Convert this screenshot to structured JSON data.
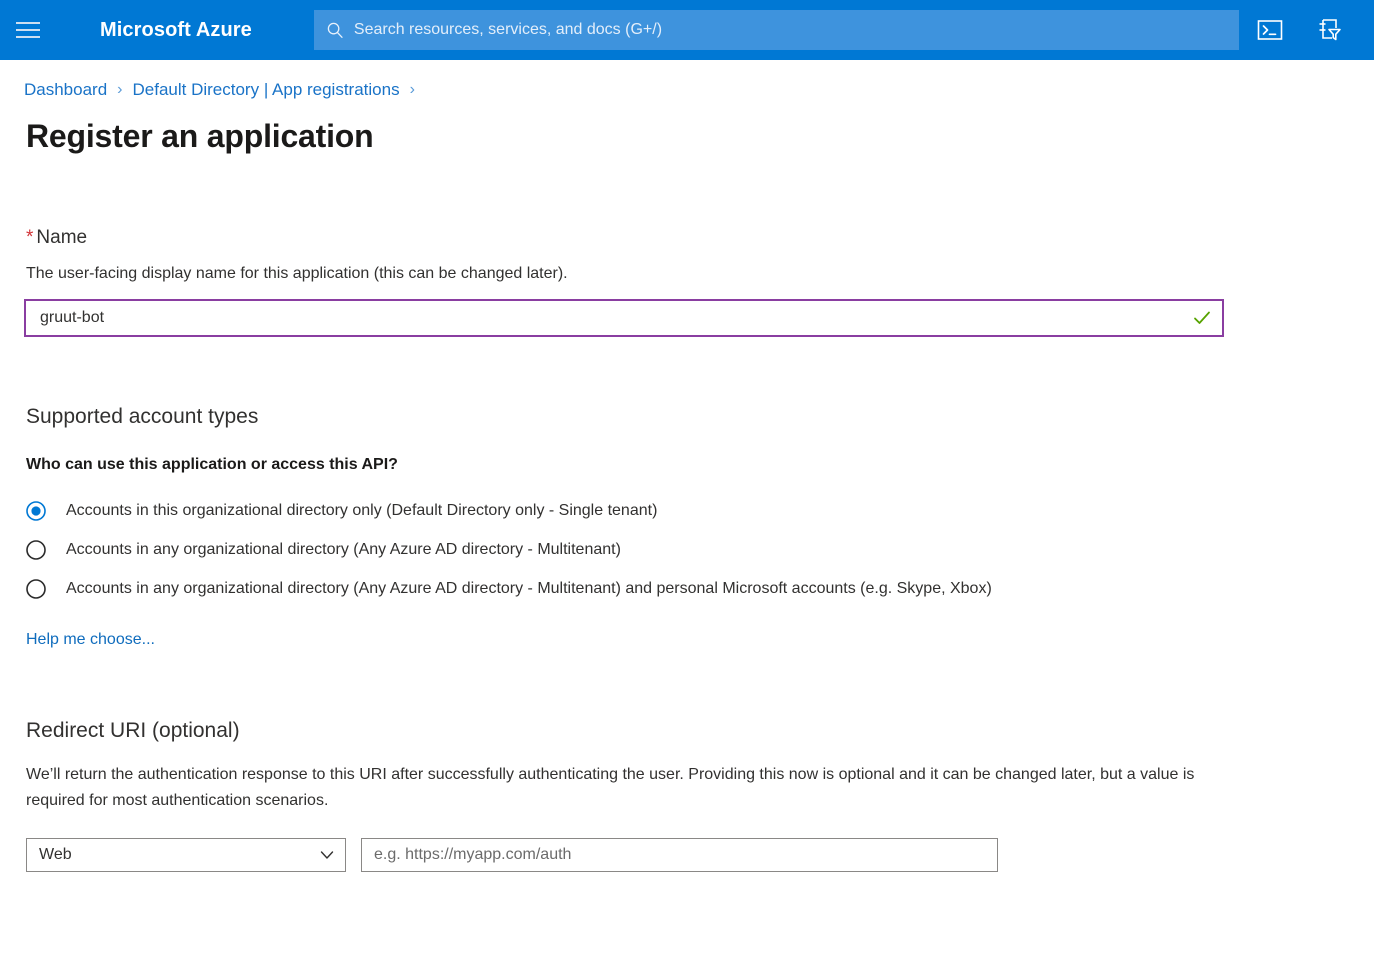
{
  "header": {
    "menu_icon": "hamburger-icon",
    "brand": "Microsoft Azure",
    "search": {
      "icon": "search-icon",
      "placeholder": "Search resources, services, and docs (G+/)",
      "value": ""
    },
    "icons": [
      {
        "name": "cloud-shell-icon",
        "label": "Cloud Shell"
      },
      {
        "name": "directories-filter-icon",
        "label": "Directories + subscriptions"
      }
    ],
    "background_color": "#0078d4",
    "search_background_color": "#3e93dd"
  },
  "breadcrumb": {
    "items": [
      {
        "label": "Dashboard"
      },
      {
        "label": "Default Directory | App registrations"
      }
    ],
    "separator": "›"
  },
  "page": {
    "title": "Register an application"
  },
  "name_field": {
    "required_marker": "*",
    "label": "Name",
    "description": "The user-facing display name for this application (this can be changed later).",
    "value": "gruut-bot",
    "placeholder": "",
    "validation_icon": "check-icon",
    "validation_color": "#57a300",
    "border_color": "#8a3ea1"
  },
  "supported_account_types": {
    "section_title": "Supported account types",
    "question": "Who can use this application or access this API?",
    "options": [
      {
        "label": "Accounts in this organizational directory only (Default Directory only - Single tenant)",
        "selected": true
      },
      {
        "label": "Accounts in any organizational directory (Any Azure AD directory - Multitenant)",
        "selected": false
      },
      {
        "label": "Accounts in any organizational directory (Any Azure AD directory - Multitenant) and personal Microsoft accounts (e.g. Skype, Xbox)",
        "selected": false
      }
    ],
    "help_link": "Help me choose...",
    "selected_color": "#0078d4"
  },
  "redirect_uri": {
    "section_title": "Redirect URI (optional)",
    "description": "We’ll return the authentication response to this URI after successfully authenticating the user. Providing this now is optional and it can be changed later, but a value is required for most authentication scenarios.",
    "platform_select": {
      "value": "Web",
      "chevron_icon": "chevron-down-icon"
    },
    "uri_input": {
      "value": "",
      "placeholder": "e.g. https://myapp.com/auth"
    }
  }
}
